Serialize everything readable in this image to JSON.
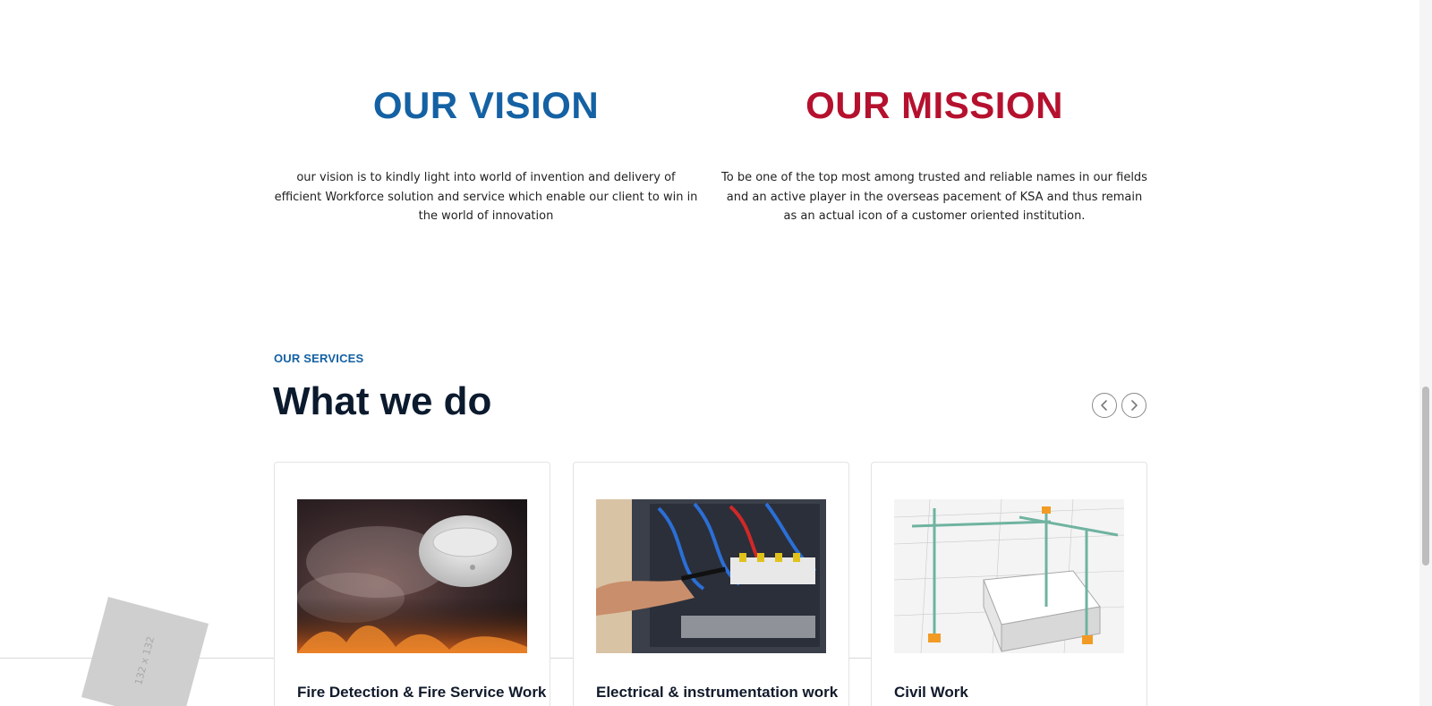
{
  "colors": {
    "vision": "#1461a3",
    "mission": "#b5112e",
    "eyebrow": "#1461a3",
    "heading": "#0c1a2e"
  },
  "vision": {
    "title": "OUR VISION",
    "text": "our vision is to kindly light into world of invention and delivery of efficient Workforce solution and service which enable our client to win in the world of innovation"
  },
  "mission": {
    "title": "OUR MISSION",
    "text": "To be one of the top most among trusted and reliable names in our fields and an active player in the overseas pacement of KSA and thus remain as an actual icon of a customer oriented institution."
  },
  "services": {
    "eyebrow": "OUR SERVICES",
    "title": "What we do",
    "prev_icon": "chevron-left-icon",
    "next_icon": "chevron-right-icon",
    "cards": [
      {
        "title": "Fire Detection & Fire Service Work",
        "image": "smoke-detector-image"
      },
      {
        "title": "Electrical & instrumentation work",
        "image": "electrical-panel-image"
      },
      {
        "title": "Civil Work",
        "image": "construction-blueprint-image"
      }
    ]
  },
  "placeholder": {
    "label": "132 x 132"
  }
}
